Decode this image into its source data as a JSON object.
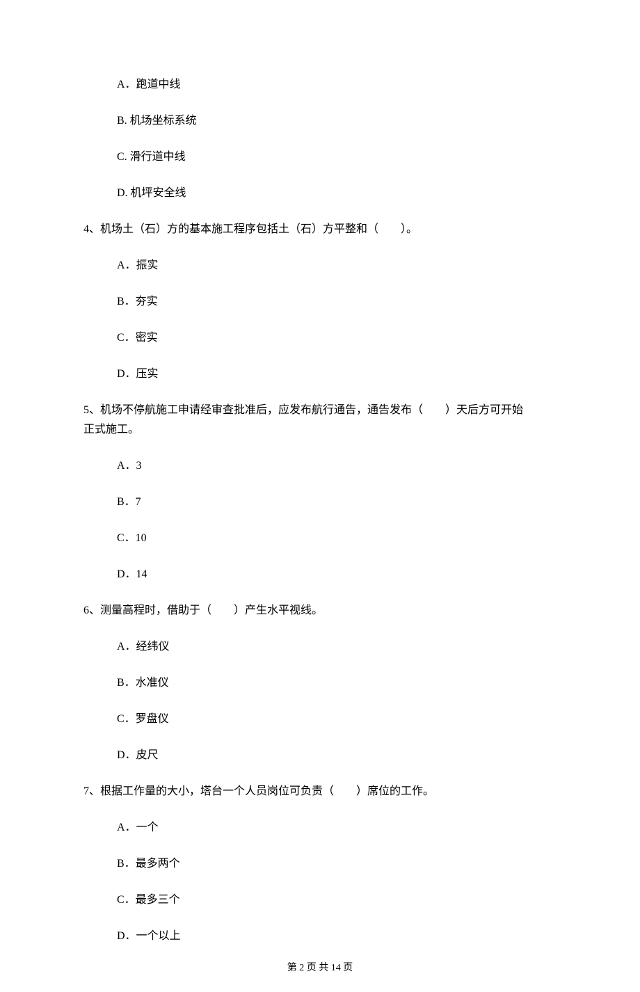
{
  "q3": {
    "options": {
      "a": "A．跑道中线",
      "b": "B. 机场坐标系统",
      "c": "C. 滑行道中线",
      "d": "D. 机坪安全线"
    }
  },
  "q4": {
    "stem": "4、机场土（石）方的基本施工程序包括土（石）方平整和（　　）。",
    "options": {
      "a": "A．振实",
      "b": "B．夯实",
      "c": "C．密实",
      "d": "D．压实"
    }
  },
  "q5": {
    "stem1": "5、机场不停航施工申请经审查批准后，应发布航行通告，通告发布（　　）天后方可开始",
    "stem2": "正式施工。",
    "options": {
      "a": "A．3",
      "b": "B．7",
      "c": "C．10",
      "d": "D．14"
    }
  },
  "q6": {
    "stem": "6、测量高程时，借助于（　　）产生水平视线。",
    "options": {
      "a": "A．经纬仪",
      "b": "B．水准仪",
      "c": "C．罗盘仪",
      "d": "D．皮尺"
    }
  },
  "q7": {
    "stem": "7、根据工作量的大小，塔台一个人员岗位可负责（　　）席位的工作。",
    "options": {
      "a": "A．一个",
      "b": "B．最多两个",
      "c": "C．最多三个",
      "d": "D．一个以上"
    }
  },
  "footer": "第 2 页 共 14 页"
}
